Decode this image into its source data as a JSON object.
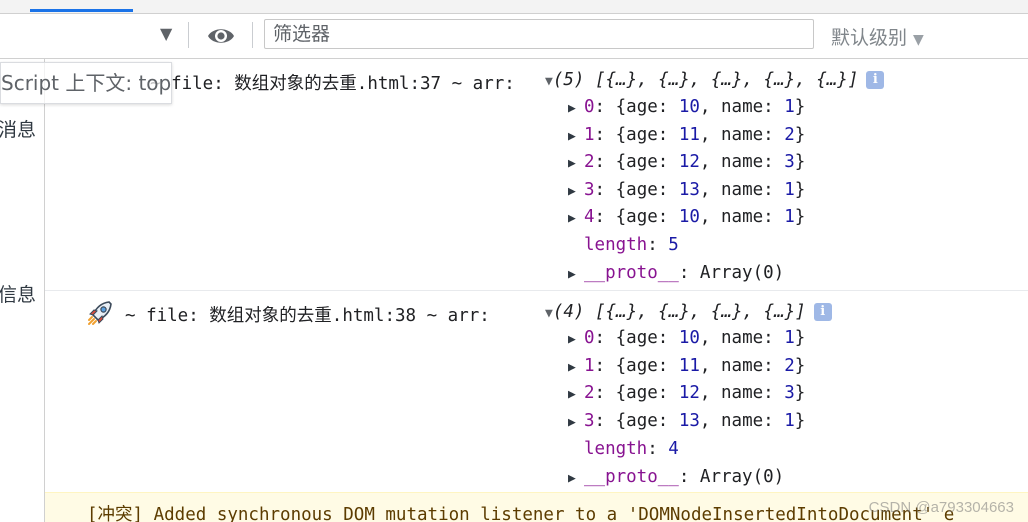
{
  "toolbar": {
    "filter_placeholder": "筛选器",
    "level_label": "默认级别"
  },
  "sidebar": {
    "label_messages": "消息",
    "label_info": "信息"
  },
  "context_tooltip": "Script 上下文: top",
  "log1": {
    "prefix": "~ file: 数组对象的去重.html:37 ~ arr:",
    "preview": "(5) [{…}, {…}, {…}, {…}, {…}]",
    "items": [
      {
        "index": "0",
        "age": "10",
        "name": "1"
      },
      {
        "index": "1",
        "age": "11",
        "name": "2"
      },
      {
        "index": "2",
        "age": "12",
        "name": "3"
      },
      {
        "index": "3",
        "age": "13",
        "name": "1"
      },
      {
        "index": "4",
        "age": "10",
        "name": "1"
      }
    ],
    "length_value": "5",
    "proto_value": "Array(0)"
  },
  "log2": {
    "prefix": "~ file: 数组对象的去重.html:38 ~ arr:",
    "preview": "(4) [{…}, {…}, {…}, {…}]",
    "items": [
      {
        "index": "0",
        "age": "10",
        "name": "1"
      },
      {
        "index": "1",
        "age": "11",
        "name": "2"
      },
      {
        "index": "2",
        "age": "12",
        "name": "3"
      },
      {
        "index": "3",
        "age": "13",
        "name": "1"
      }
    ],
    "length_value": "4",
    "proto_value": "Array(0)"
  },
  "labels": {
    "age_key": "age",
    "name_key": "name",
    "length_key": "length",
    "proto_key": "__proto__"
  },
  "warning": {
    "text": "[冲突] Added synchronous DOM mutation listener to a 'DOMNodeInsertedIntoDocument' e"
  },
  "watermark": "CSDN @a793304663",
  "icons": {
    "dropdown": "chevron-down-icon",
    "eye": "eye-icon",
    "rocket": "rocket-emoji-icon",
    "info": "info-icon",
    "expand": "triangle-right-icon",
    "collapse": "triangle-down-icon"
  },
  "colors": {
    "key": "#881391",
    "number": "#1a1aa6",
    "warning_bg": "#fffbe5",
    "info_badge": "#9fb8e6"
  }
}
